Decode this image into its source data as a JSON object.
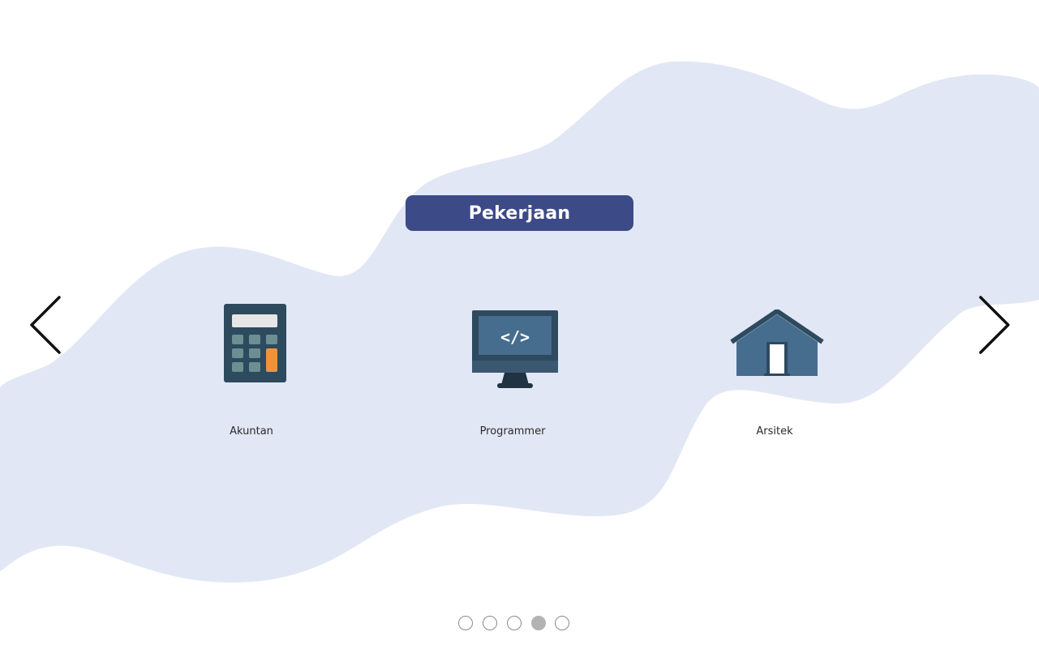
{
  "header": {
    "title": "Pekerjaan"
  },
  "carousel": {
    "items": [
      {
        "label": "Akuntan",
        "icon": "calculator-icon"
      },
      {
        "label": "Programmer",
        "icon": "monitor-code-icon"
      },
      {
        "label": "Arsitek",
        "icon": "house-icon"
      }
    ],
    "prev_icon": "chevron-left-icon",
    "next_icon": "chevron-right-icon",
    "pagination": {
      "count": 5,
      "active_index": 3
    }
  },
  "colors": {
    "background_blob": "#e2e7f5",
    "title_bg": "#3c4a87",
    "title_text": "#ffffff",
    "icon_dark": "#2e4a5f",
    "icon_blue": "#466d8e",
    "accent_orange": "#f0923a"
  }
}
